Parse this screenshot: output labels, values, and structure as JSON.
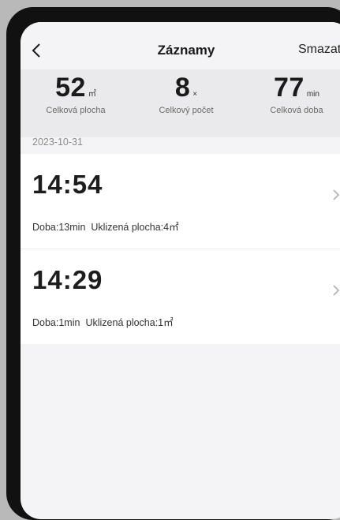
{
  "header": {
    "title": "Záznamy",
    "delete_label": "Smazat",
    "back_icon": "chevron-left-icon"
  },
  "stats": [
    {
      "value": "52",
      "unit": "㎡",
      "label": "Celková plocha"
    },
    {
      "value": "8",
      "unit": "×",
      "label": "Celkový počet"
    },
    {
      "value": "77",
      "unit": "min",
      "label": "Celková doba"
    }
  ],
  "date_group": "2023-10-31",
  "records": [
    {
      "time": "14:54",
      "duration": "Doba:13min",
      "area": "Uklizená plocha:4㎡",
      "chevron_icon": "chevron-right-icon"
    },
    {
      "time": "14:29",
      "duration": "Doba:1min",
      "area": "Uklizená plocha:1㎡",
      "chevron_icon": "chevron-right-icon"
    }
  ],
  "colors": {
    "background": "#f4f4f6",
    "stats_band": "#eaeaec",
    "card": "#ffffff",
    "frame": "#111111"
  }
}
